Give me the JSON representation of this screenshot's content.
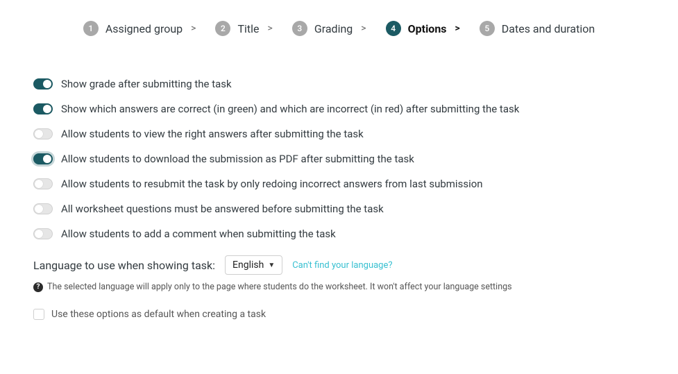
{
  "stepper": {
    "items": [
      {
        "num": "1",
        "label": "Assigned group",
        "active": false
      },
      {
        "num": "2",
        "label": "Title",
        "active": false
      },
      {
        "num": "3",
        "label": "Grading",
        "active": false
      },
      {
        "num": "4",
        "label": "Options",
        "active": true
      },
      {
        "num": "5",
        "label": "Dates and duration",
        "active": false
      }
    ],
    "caret": ">"
  },
  "options": [
    {
      "key": "show-grade",
      "on": true,
      "focus": false,
      "label": "Show grade after submitting the task"
    },
    {
      "key": "show-correct",
      "on": true,
      "focus": false,
      "label": "Show which answers are correct (in green) and which are incorrect (in red) after submitting the task"
    },
    {
      "key": "view-right",
      "on": false,
      "focus": false,
      "label": "Allow students to view the right answers after submitting the task"
    },
    {
      "key": "download-pdf",
      "on": true,
      "focus": true,
      "label": "Allow students to download the submission as PDF after submitting the task"
    },
    {
      "key": "resubmit",
      "on": false,
      "focus": false,
      "label": "Allow students to resubmit the task by only redoing incorrect answers from last submission"
    },
    {
      "key": "must-answer-all",
      "on": false,
      "focus": false,
      "label": "All worksheet questions must be answered before submitting the task"
    },
    {
      "key": "add-comment",
      "on": false,
      "focus": false,
      "label": "Allow students to add a comment when submitting the task"
    }
  ],
  "language": {
    "label": "Language to use when showing task:",
    "selected": "English",
    "help_link": "Can't find your language?"
  },
  "hint": {
    "icon_glyph": "?",
    "text": "The selected language will apply only to the page where students do the worksheet. It won't affect your language settings"
  },
  "defaults": {
    "checked": false,
    "label": "Use these options as default when creating a task"
  }
}
